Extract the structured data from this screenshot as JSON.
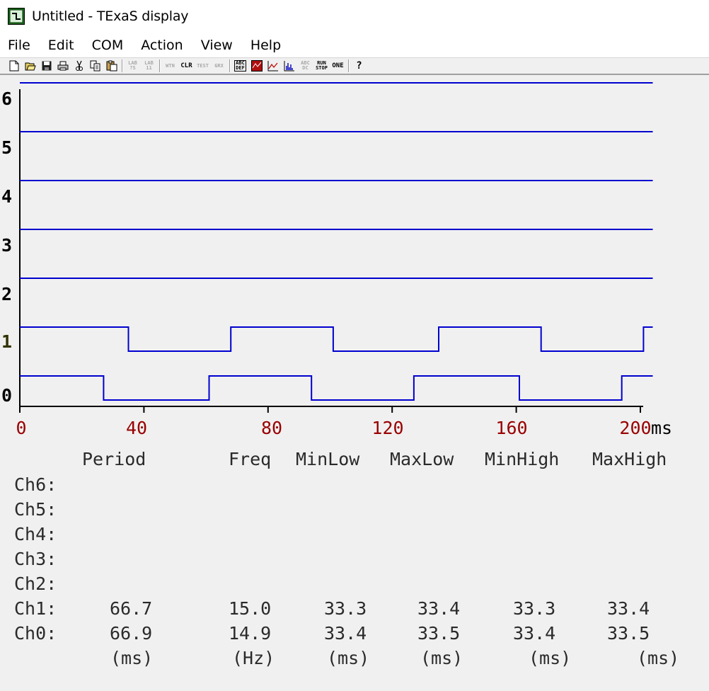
{
  "window": {
    "title": "Untitled - TExaS display"
  },
  "menu": [
    "File",
    "Edit",
    "COM",
    "Action",
    "View",
    "Help"
  ],
  "toolbar": {
    "groups": [
      [
        "new-icon",
        "open-icon",
        "save-icon",
        "print-icon",
        "cut-icon",
        "copy-icon",
        "paste-icon"
      ],
      [
        "lab-icon",
        "lab-icon",
        "filter-icon",
        "clear-icon",
        "test-icon",
        "grader-icon"
      ],
      [
        "abc-def-icon",
        "record-icon",
        "line-chart-icon",
        "histogram-icon",
        "abc-dc-icon",
        "run-stop-icon",
        "one-icon"
      ],
      [
        "help-icon"
      ]
    ]
  },
  "colors": {
    "trace": "#0000d0",
    "axis": "#000000",
    "axis_labels": "#990000",
    "background": "#f0f0f0"
  },
  "chart_data": {
    "type": "line",
    "xlabel": "ms",
    "x_ticks": [
      "0",
      "40",
      "80",
      "120",
      "160",
      "200"
    ],
    "xlim": [
      0,
      200
    ],
    "channel_labels": [
      "0",
      "1",
      "2",
      "3",
      "4",
      "5",
      "6"
    ],
    "series": [
      {
        "name": "0",
        "x": [
          0,
          27,
          27,
          61,
          61,
          94,
          94,
          127,
          127,
          161,
          161,
          194,
          194,
          204
        ],
        "y": [
          1,
          1,
          0,
          0,
          1,
          1,
          0,
          0,
          1,
          1,
          0,
          0,
          1,
          1
        ]
      },
      {
        "name": "1",
        "x": [
          0,
          35,
          35,
          68,
          68,
          101,
          101,
          135,
          135,
          168,
          168,
          201,
          201,
          204
        ],
        "y": [
          1,
          1,
          0,
          0,
          1,
          1,
          0,
          0,
          1,
          1,
          0,
          0,
          1,
          1
        ]
      },
      {
        "name": "2",
        "x": [
          0,
          204
        ],
        "y": [
          1,
          1
        ]
      },
      {
        "name": "3",
        "x": [
          0,
          204
        ],
        "y": [
          1,
          1
        ]
      },
      {
        "name": "4",
        "x": [
          0,
          204
        ],
        "y": [
          1,
          1
        ]
      },
      {
        "name": "5",
        "x": [
          0,
          204
        ],
        "y": [
          1,
          1
        ]
      },
      {
        "name": "6",
        "x": [
          0,
          204
        ],
        "y": [
          1,
          1
        ]
      }
    ]
  },
  "stats": {
    "headers": [
      "Period",
      "Freq",
      "MinLow",
      "MaxLow",
      "MinHigh",
      "MaxHigh"
    ],
    "rows": [
      {
        "label": "Ch6:",
        "values": []
      },
      {
        "label": "Ch5:",
        "values": []
      },
      {
        "label": "Ch4:",
        "values": []
      },
      {
        "label": "Ch3:",
        "values": []
      },
      {
        "label": "Ch2:",
        "values": []
      },
      {
        "label": "Ch1:",
        "values": [
          "66.7",
          "15.0",
          "33.3",
          "33.4",
          "33.3",
          "33.4"
        ]
      },
      {
        "label": "Ch0:",
        "values": [
          "66.9",
          "14.9",
          "33.4",
          "33.5",
          "33.4",
          "33.5"
        ]
      }
    ],
    "units": [
      "(ms)",
      "(Hz)",
      "(ms)",
      "(ms)",
      "(ms)",
      "(ms)"
    ]
  }
}
